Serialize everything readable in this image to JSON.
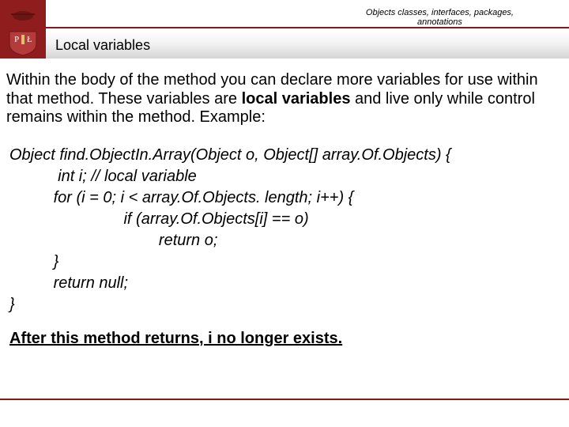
{
  "header": {
    "breadcrumb_line1": "Objects classes, interfaces, packages,",
    "breadcrumb_line2": "annotations",
    "title": "Local variables"
  },
  "body": {
    "para_before": "Within the body of the method you can declare more variables for use within that method. These variables are ",
    "para_bold": "local variables",
    "para_after": " and live only while control remains within the method. Example:"
  },
  "code": {
    "l1": "Object find.ObjectIn.Array(Object o, Object[] array.Of.Objects) {",
    "l2": "           int i; // local variable",
    "l3": "          for (i = 0; i < array.Of.Objects. length; i++) {",
    "l4": "                          if (array.Of.Objects[i] == o)",
    "l5": "                                  return o;",
    "l6": "          }",
    "l7": "          return null;",
    "l8": "}"
  },
  "footer": {
    "line": "After this method returns, i no longer exists."
  }
}
